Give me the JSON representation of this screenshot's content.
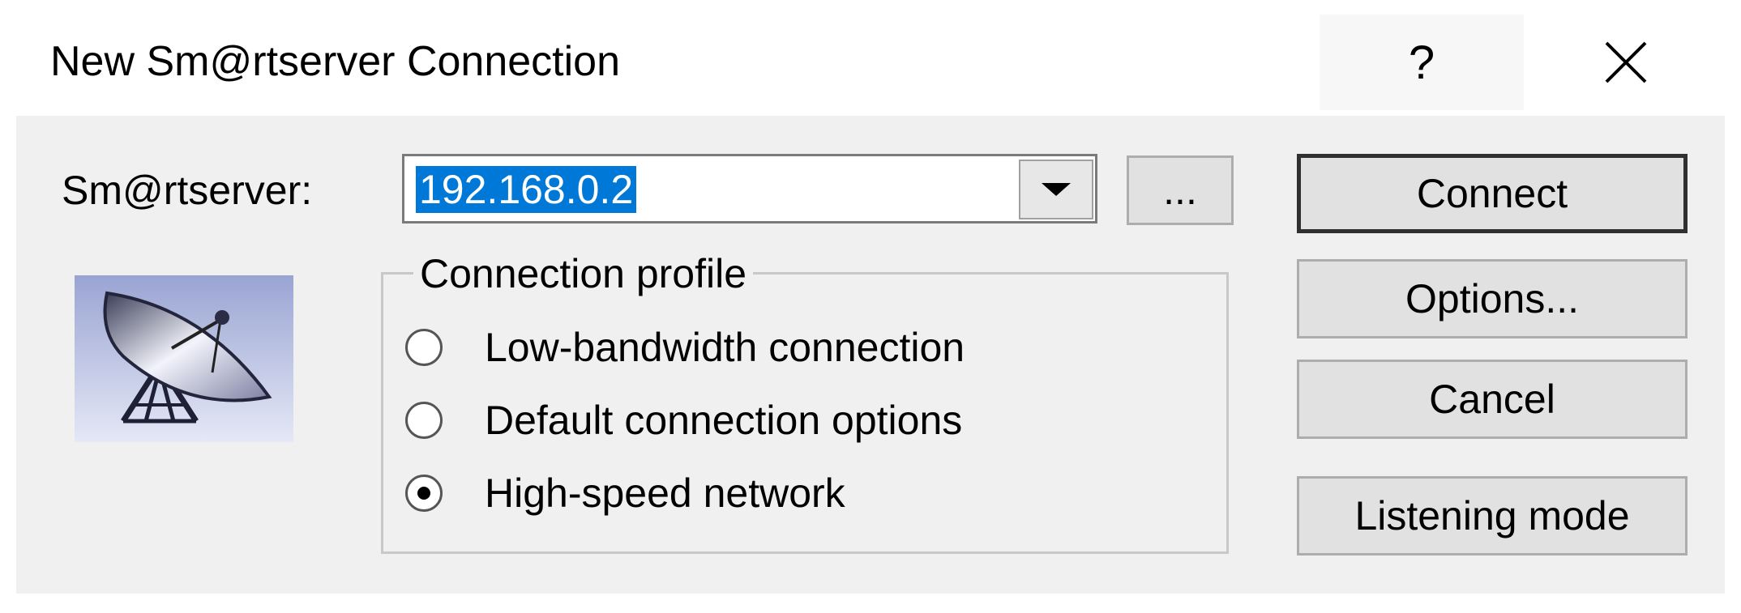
{
  "window": {
    "title": "New Sm@rtserver Connection",
    "help_label": "?",
    "close_icon": "close-icon"
  },
  "server": {
    "label": "Sm@rtserver:",
    "value": "192.168.0.2",
    "browse_label": "..."
  },
  "image": {
    "icon": "satellite-dish-icon"
  },
  "profile": {
    "legend": "Connection profile",
    "options": [
      {
        "label": "Low-bandwidth connection",
        "selected": false
      },
      {
        "label": "Default connection options",
        "selected": false
      },
      {
        "label": "High-speed network",
        "selected": true
      }
    ]
  },
  "buttons": {
    "connect": "Connect",
    "options": "Options...",
    "cancel": "Cancel",
    "listening": "Listening mode"
  }
}
